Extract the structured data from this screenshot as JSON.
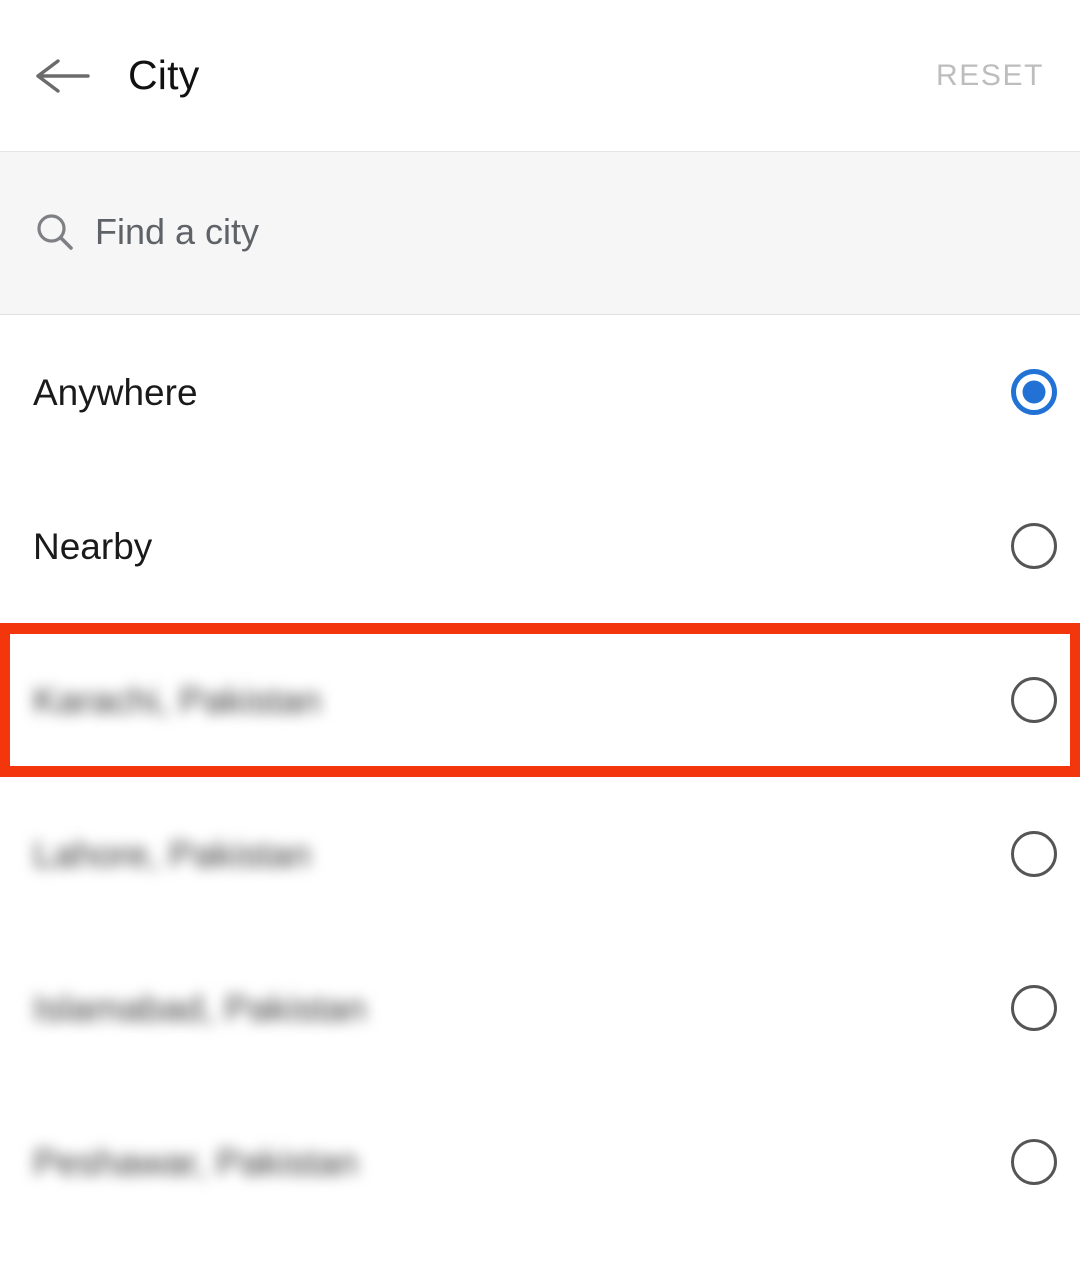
{
  "header": {
    "back_icon": "arrow-left-icon",
    "title": "City",
    "reset_label": "RESET"
  },
  "search": {
    "icon": "search-icon",
    "placeholder": "Find a city",
    "value": ""
  },
  "list": {
    "items": [
      {
        "label": "Anywhere",
        "selected": true,
        "blurred": false,
        "highlighted": false
      },
      {
        "label": "Nearby",
        "selected": false,
        "blurred": false,
        "highlighted": false
      },
      {
        "label": "Karachi, Pakistan",
        "selected": false,
        "blurred": true,
        "highlighted": true
      },
      {
        "label": "Lahore, Pakistan",
        "selected": false,
        "blurred": true,
        "highlighted": false
      },
      {
        "label": "Islamabad, Pakistan",
        "selected": false,
        "blurred": true,
        "highlighted": false
      },
      {
        "label": "Peshawar, Pakistan",
        "selected": false,
        "blurred": true,
        "highlighted": false
      }
    ]
  },
  "colors": {
    "accent_selected": "#2272d6",
    "radio_unselected": "#555555",
    "highlight_box": "#f4360c",
    "reset_text": "#bdbdbd",
    "search_background": "#f6f6f6"
  }
}
